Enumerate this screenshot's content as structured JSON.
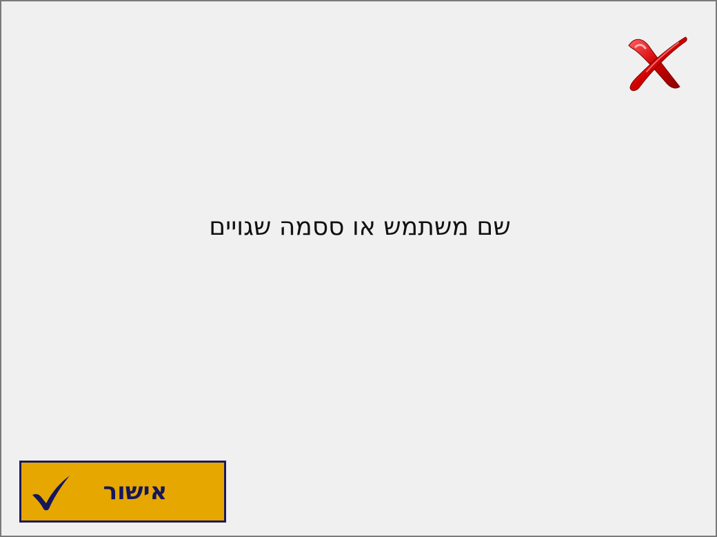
{
  "dialog": {
    "message": "שם משתמש או ססמה שגויים",
    "close_icon": "red-x-close-icon",
    "ok_button": {
      "label": "אישור",
      "icon": "checkmark-icon",
      "background_color": "#e6a800",
      "border_color": "#1a1a5e",
      "text_color": "#16165a"
    },
    "background_color": "#f0f0f0",
    "close_icon_color": "#d00000"
  }
}
